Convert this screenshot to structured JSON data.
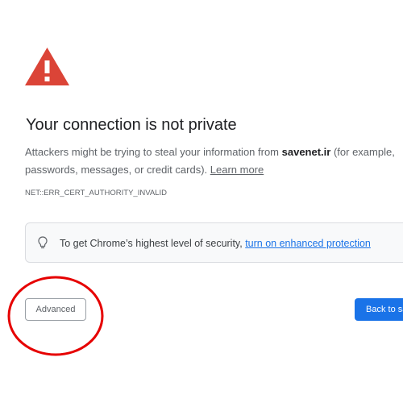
{
  "icons": {
    "warning": "warning-triangle-icon",
    "bulb": "lightbulb-icon"
  },
  "colors": {
    "warning_red": "#db4437",
    "link_blue": "#1a73e8",
    "button_blue": "#1a73e8",
    "highlight_red": "#e60000"
  },
  "interstitial": {
    "heading": "Your connection is not private",
    "explanation_prefix": "Attackers might be trying to steal your information from ",
    "host": "savenet.ir",
    "explanation_suffix": " (for example, passwords, messages, or credit cards). ",
    "learn_more": "Learn more",
    "error_code": "NET::ERR_CERT_AUTHORITY_INVALID",
    "enhanced_text": "To get Chrome’s highest level of security, ",
    "enhanced_link": "turn on enhanced protection",
    "advanced_button": "Advanced",
    "back_button": "Back to safety"
  }
}
